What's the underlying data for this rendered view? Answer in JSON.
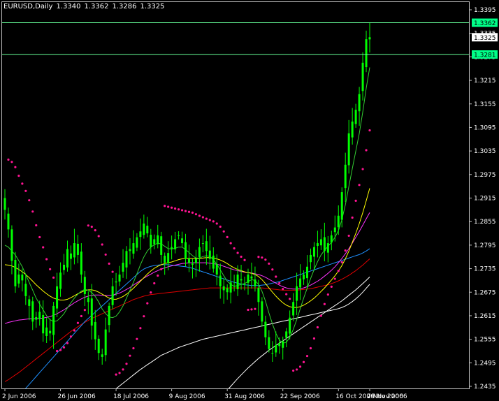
{
  "header": {
    "symbol": "EURUSD,Daily",
    "open": "1.3340",
    "high": "1.3362",
    "low": "1.3286",
    "close": "1.3325"
  },
  "price_axis": {
    "ticks": [
      "1.3395",
      "1.3335",
      "1.3275",
      "1.3215",
      "1.3155",
      "1.3095",
      "1.3035",
      "1.2975",
      "1.2915",
      "1.2855",
      "1.2795",
      "1.2735",
      "1.2675",
      "1.2615",
      "1.2555",
      "1.2495",
      "1.2435"
    ],
    "markers": [
      {
        "label": "1.3362",
        "value": 1.3362,
        "style": "green"
      },
      {
        "label": "1.3325",
        "value": 1.3325,
        "style": "white"
      },
      {
        "label": "1.3281",
        "value": 1.3281,
        "style": "green"
      }
    ]
  },
  "time_axis": {
    "labels": [
      "2 Jun 2006",
      "26 Jun 2006",
      "18 Jul 2006",
      "9 Aug 2006",
      "31 Aug 2006",
      "22 Sep 2006",
      "16 Oct 2006",
      "7 Nov 2006",
      "29 Nov 2006"
    ]
  },
  "colors": {
    "background": "#000000",
    "candle": "#00ff00",
    "sar": "#ff1493",
    "hline": "#66ff99",
    "ma_green": "#32cd32",
    "ma_yellow": "#ffff00",
    "ma_magenta": "#ff33ff",
    "ma_blue": "#1e90ff",
    "ma_red": "#e00000",
    "ma_white1": "#ffffff",
    "ma_white2": "#ffffff"
  },
  "chart_data": {
    "type": "candlestick",
    "symbol": "EURUSD",
    "timeframe": "Daily",
    "y_range": [
      1.2435,
      1.3395
    ],
    "closes": [
      1.2885,
      1.2835,
      1.2755,
      1.269,
      1.272,
      1.2705,
      1.2665,
      1.264,
      1.26,
      1.2605,
      1.2625,
      1.257,
      1.2585,
      1.257,
      1.264,
      1.269,
      1.2725,
      1.2745,
      1.2785,
      1.276,
      1.28,
      1.277,
      1.272,
      1.267,
      1.265,
      1.259,
      1.2555,
      1.252,
      1.251,
      1.258,
      1.264,
      1.269,
      1.27,
      1.272,
      1.275,
      1.278,
      1.278,
      1.28,
      1.2815,
      1.283,
      1.285,
      1.2825,
      1.279,
      1.281,
      1.282,
      1.277,
      1.275,
      1.2775,
      1.279,
      1.281,
      1.282,
      1.28,
      1.276,
      1.275,
      1.2745,
      1.276,
      1.279,
      1.28,
      1.278,
      1.276,
      1.2735,
      1.272,
      1.269,
      1.268,
      1.2675,
      1.27,
      1.269,
      1.272,
      1.2705,
      1.2695,
      1.272,
      1.271,
      1.269,
      1.265,
      1.26,
      1.256,
      1.253,
      1.252,
      1.254,
      1.2545,
      1.255,
      1.2575,
      1.261,
      1.265,
      1.269,
      1.271,
      1.272,
      1.274,
      1.277,
      1.279,
      1.28,
      1.281,
      1.278,
      1.28,
      1.282,
      1.284,
      1.287,
      1.293,
      1.3,
      1.308,
      1.311,
      1.314,
      1.318,
      1.326,
      1.332,
      1.3325
    ],
    "ma_green": [
      1.2795,
      1.279,
      1.278,
      1.277,
      1.2755,
      1.274,
      1.272,
      1.27,
      1.268,
      1.266,
      1.2645,
      1.263,
      1.2615,
      1.2605,
      1.26,
      1.2602,
      1.261,
      1.262,
      1.2635,
      1.2648,
      1.266,
      1.267,
      1.2678,
      1.2682,
      1.268,
      1.2674,
      1.2664,
      1.265,
      1.2632,
      1.262,
      1.2612,
      1.261,
      1.2614,
      1.2625,
      1.264,
      1.266,
      1.268,
      1.27,
      1.2722,
      1.2745,
      1.2765,
      1.278,
      1.279,
      1.2796,
      1.28,
      1.2798,
      1.2792,
      1.2786,
      1.2785,
      1.2787,
      1.279,
      1.279,
      1.2784,
      1.2776,
      1.2768,
      1.2762,
      1.2762,
      1.2766,
      1.2768,
      1.2766,
      1.2758,
      1.2746,
      1.2732,
      1.2717,
      1.2703,
      1.2695,
      1.269,
      1.2692,
      1.2695,
      1.2697,
      1.2702,
      1.2707,
      1.2705,
      1.2695,
      1.2677,
      1.2652,
      1.2622,
      1.2594,
      1.257,
      1.2553,
      1.2545,
      1.2547,
      1.256,
      1.258,
      1.2605,
      1.2633,
      1.266,
      1.2685,
      1.271,
      1.2733,
      1.2753,
      1.277,
      1.2782,
      1.2792,
      1.2802,
      1.2815,
      1.2832,
      1.286,
      1.2898,
      1.2945,
      1.299,
      1.3035,
      1.308,
      1.3135,
      1.3195,
      1.3248
    ],
    "ma_yellow": [
      1.2745,
      1.2744,
      1.2742,
      1.2738,
      1.2733,
      1.2727,
      1.272,
      1.2712,
      1.2703,
      1.2694,
      1.2686,
      1.2678,
      1.2671,
      1.2665,
      1.266,
      1.2657,
      1.2655,
      1.2655,
      1.2657,
      1.2661,
      1.2666,
      1.2671,
      1.2675,
      1.2679,
      1.2681,
      1.2681,
      1.2679,
      1.2675,
      1.267,
      1.2665,
      1.266,
      1.2657,
      1.2657,
      1.266,
      1.2664,
      1.267,
      1.2677,
      1.2685,
      1.2694,
      1.2703,
      1.2712,
      1.2721,
      1.2729,
      1.2736,
      1.2741,
      1.2745,
      1.2748,
      1.275,
      1.2752,
      1.2755,
      1.2758,
      1.276,
      1.2761,
      1.2761,
      1.2761,
      1.2761,
      1.2761,
      1.2762,
      1.2763,
      1.2763,
      1.2762,
      1.276,
      1.2757,
      1.2753,
      1.2748,
      1.2742,
      1.2737,
      1.2733,
      1.273,
      1.2727,
      1.2725,
      1.2723,
      1.272,
      1.2715,
      1.2707,
      1.2697,
      1.2686,
      1.2675,
      1.2665,
      1.2656,
      1.2648,
      1.2642,
      1.2638,
      1.2636,
      1.2636,
      1.2638,
      1.2642,
      1.2647,
      1.2653,
      1.266,
      1.2668,
      1.2677,
      1.2686,
      1.2696,
      1.2706,
      1.2717,
      1.2729,
      1.2743,
      1.276,
      1.278,
      1.2802,
      1.2825,
      1.285,
      1.2878,
      1.2908,
      1.294
    ],
    "ma_magenta": [
      1.2595,
      1.2598,
      1.26,
      1.2602,
      1.2604,
      1.2605,
      1.2606,
      1.2607,
      1.2607,
      1.2607,
      1.2608,
      1.2609,
      1.2611,
      1.2613,
      1.2616,
      1.262,
      1.2625,
      1.263,
      1.2636,
      1.2642,
      1.2648,
      1.2653,
      1.2658,
      1.2662,
      1.2665,
      1.2667,
      1.2668,
      1.2668,
      1.2667,
      1.2667,
      1.2667,
      1.2668,
      1.267,
      1.2673,
      1.2677,
      1.2682,
      1.2687,
      1.2693,
      1.2699,
      1.2705,
      1.2711,
      1.2716,
      1.2721,
      1.2726,
      1.273,
      1.2734,
      1.2737,
      1.274,
      1.2742,
      1.2744,
      1.2746,
      1.2748,
      1.2749,
      1.275,
      1.275,
      1.275,
      1.275,
      1.275,
      1.275,
      1.2749,
      1.2748,
      1.2746,
      1.2744,
      1.2741,
      1.2738,
      1.2735,
      1.2732,
      1.273,
      1.2728,
      1.2726,
      1.2725,
      1.2724,
      1.2722,
      1.272,
      1.2717,
      1.2713,
      1.2708,
      1.2703,
      1.2698,
      1.2693,
      1.2689,
      1.2686,
      1.2684,
      1.2683,
      1.2683,
      1.2684,
      1.2686,
      1.2689,
      1.2693,
      1.2698,
      1.2703,
      1.2709,
      1.2716,
      1.2723,
      1.2731,
      1.274,
      1.275,
      1.2761,
      1.2773,
      1.2786,
      1.28,
      1.2815,
      1.283,
      1.2846,
      1.2862,
      1.2878
    ],
    "ma_blue": [
      1.237,
      1.238,
      1.239,
      1.24,
      1.241,
      1.242,
      1.243,
      1.244,
      1.245,
      1.246,
      1.247,
      1.248,
      1.249,
      1.25,
      1.251,
      1.252,
      1.253,
      1.254,
      1.255,
      1.256,
      1.257,
      1.258,
      1.259,
      1.26,
      1.2608,
      1.2616,
      1.2624,
      1.2632,
      1.264,
      1.2648,
      1.2656,
      1.2664,
      1.2672,
      1.268,
      1.2688,
      1.2696,
      1.2704,
      1.2712,
      1.272,
      1.2728,
      1.2734,
      1.2738,
      1.2741,
      1.2743,
      1.2744,
      1.2745,
      1.2745,
      1.2745,
      1.2744,
      1.2743,
      1.2742,
      1.2741,
      1.274,
      1.2738,
      1.2736,
      1.2733,
      1.273,
      1.2727,
      1.2724,
      1.2721,
      1.2718,
      1.2715,
      1.2712,
      1.2709,
      1.2706,
      1.2703,
      1.27,
      1.2698,
      1.2696,
      1.2694,
      1.2693,
      1.2692,
      1.2692,
      1.2692,
      1.2693,
      1.2694,
      1.2696,
      1.2698,
      1.27,
      1.2702,
      1.2705,
      1.2708,
      1.2711,
      1.2714,
      1.2717,
      1.272,
      1.2723,
      1.2726,
      1.2729,
      1.2732,
      1.2735,
      1.2738,
      1.2741,
      1.2744,
      1.2747,
      1.275,
      1.2753,
      1.2756,
      1.2759,
      1.2762,
      1.2765,
      1.2768,
      1.2771,
      1.2775,
      1.278,
      1.2786
    ],
    "ma_red": [
      1.2447,
      1.2452,
      1.2458,
      1.2464,
      1.247,
      1.2477,
      1.2484,
      1.2491,
      1.2498,
      1.2505,
      1.2512,
      1.2519,
      1.2526,
      1.2533,
      1.254,
      1.2547,
      1.2554,
      1.2561,
      1.2568,
      1.2575,
      1.2581,
      1.2587,
      1.2593,
      1.2598,
      1.2603,
      1.2608,
      1.2612,
      1.2616,
      1.262,
      1.2624,
      1.2628,
      1.2632,
      1.2636,
      1.264,
      1.2644,
      1.2648,
      1.2652,
      1.2656,
      1.2659,
      1.2662,
      1.2665,
      1.2667,
      1.2669,
      1.267,
      1.2671,
      1.2672,
      1.2673,
      1.2674,
      1.2675,
      1.2676,
      1.2677,
      1.2678,
      1.2679,
      1.268,
      1.2681,
      1.2682,
      1.2683,
      1.2684,
      1.2685,
      1.2686,
      1.2686,
      1.2686,
      1.2686,
      1.2686,
      1.2686,
      1.2686,
      1.2686,
      1.2686,
      1.2686,
      1.2686,
      1.2686,
      1.2686,
      1.2686,
      1.2686,
      1.2686,
      1.2685,
      1.2684,
      1.2683,
      1.2682,
      1.2681,
      1.268,
      1.268,
      1.268,
      1.268,
      1.268,
      1.2681,
      1.2682,
      1.2683,
      1.2684,
      1.2686,
      1.2688,
      1.269,
      1.2692,
      1.2694,
      1.2697,
      1.27,
      1.2704,
      1.2708,
      1.2713,
      1.2718,
      1.2724,
      1.273,
      1.2737,
      1.2744,
      1.2752,
      1.276
    ],
    "ma_white1": [
      null,
      null,
      null,
      null,
      null,
      null,
      null,
      null,
      null,
      null,
      null,
      null,
      null,
      null,
      null,
      null,
      null,
      null,
      null,
      null,
      null,
      null,
      null,
      null,
      null,
      null,
      null,
      null,
      null,
      null,
      1.2415,
      1.2422,
      1.2429,
      1.2436,
      1.2443,
      1.245,
      1.2457,
      1.2464,
      1.2471,
      1.2478,
      1.2484,
      1.249,
      1.2496,
      1.2502,
      1.2508,
      1.2514,
      1.2518,
      1.2522,
      1.2526,
      1.253,
      1.2534,
      1.2537,
      1.254,
      1.2543,
      1.2546,
      1.2549,
      1.2552,
      1.2555,
      1.2557,
      1.2559,
      1.2561,
      1.2563,
      1.2565,
      1.2567,
      1.2569,
      1.2571,
      1.2573,
      1.2575,
      1.2577,
      1.2579,
      1.2581,
      1.2583,
      1.2585,
      1.2587,
      1.2589,
      1.2591,
      1.2593,
      1.2595,
      1.2597,
      1.2599,
      1.2601,
      1.2603,
      1.2605,
      1.2607,
      1.2609,
      1.2611,
      1.2613,
      1.2615,
      1.2617,
      1.2619,
      1.2621,
      1.2623,
      1.2625,
      1.2627,
      1.2629,
      1.2631,
      1.2633,
      1.2636,
      1.264,
      1.2645,
      1.2651,
      1.2658,
      1.2666,
      1.2675,
      1.2685,
      1.2695
    ],
    "ma_white2": [
      null,
      null,
      null,
      null,
      null,
      null,
      null,
      null,
      null,
      null,
      null,
      null,
      null,
      null,
      null,
      null,
      null,
      null,
      null,
      null,
      null,
      null,
      null,
      null,
      null,
      null,
      null,
      null,
      null,
      null,
      null,
      null,
      null,
      null,
      null,
      null,
      null,
      null,
      null,
      null,
      null,
      null,
      null,
      null,
      null,
      null,
      null,
      null,
      null,
      null,
      null,
      null,
      null,
      null,
      null,
      null,
      null,
      null,
      null,
      null,
      null,
      null,
      null,
      null,
      1.2425,
      1.2435,
      1.2445,
      1.2455,
      1.2464,
      1.2473,
      1.2482,
      1.249,
      1.2498,
      1.2506,
      1.2513,
      1.252,
      1.2527,
      1.2533,
      1.2539,
      1.2545,
      1.2551,
      1.2557,
      1.2563,
      1.2569,
      1.2575,
      1.2581,
      1.2587,
      1.2593,
      1.2599,
      1.2605,
      1.2611,
      1.2617,
      1.2623,
      1.2629,
      1.2635,
      1.2641,
      1.2647,
      1.2653,
      1.266,
      1.2667,
      1.2674,
      1.2681,
      1.2689,
      1.2697,
      1.2705,
      1.2714
    ]
  }
}
